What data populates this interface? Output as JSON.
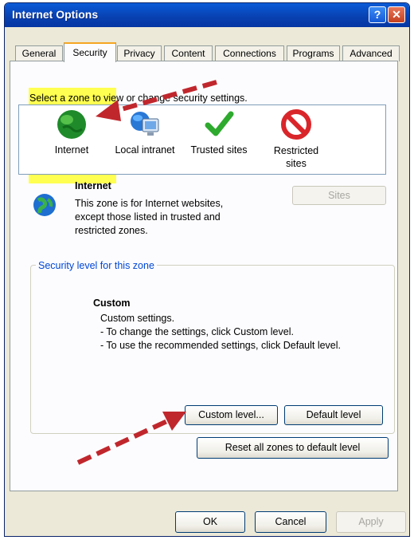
{
  "window": {
    "title": "Internet Options",
    "help_glyph": "?",
    "close_glyph": "✕"
  },
  "tabs": [
    "General",
    "Security",
    "Privacy",
    "Content",
    "Connections",
    "Programs",
    "Advanced"
  ],
  "active_tab": "Security",
  "zone_prompt": "Select a zone to view or change security settings.",
  "zones": [
    {
      "label": "Internet",
      "icon": "globe-icon"
    },
    {
      "label": "Local intranet",
      "icon": "intranet-icon"
    },
    {
      "label": "Trusted sites",
      "icon": "checkmark-icon"
    },
    {
      "label_line1": "Restricted",
      "label_line2": "sites",
      "icon": "no-entry-icon"
    }
  ],
  "selected_zone": {
    "name": "Internet",
    "desc_line1": "This zone is for Internet websites,",
    "desc_line2": "except those listed in trusted and",
    "desc_line3": "restricted zones.",
    "sites_button": "Sites"
  },
  "security_level": {
    "group_title": "Security level for this zone",
    "level": "Custom",
    "line1": "Custom settings.",
    "line2": "- To change the settings, click Custom level.",
    "line3": "- To use the recommended settings, click Default level."
  },
  "buttons": {
    "custom_level": "Custom level...",
    "default_level": "Default level",
    "reset_all": "Reset all zones to default level",
    "ok": "OK",
    "cancel": "Cancel",
    "apply": "Apply"
  },
  "colors": {
    "highlight": "#ffff33",
    "arrow": "#c0272d",
    "titlebar": "#0a5bd8"
  }
}
